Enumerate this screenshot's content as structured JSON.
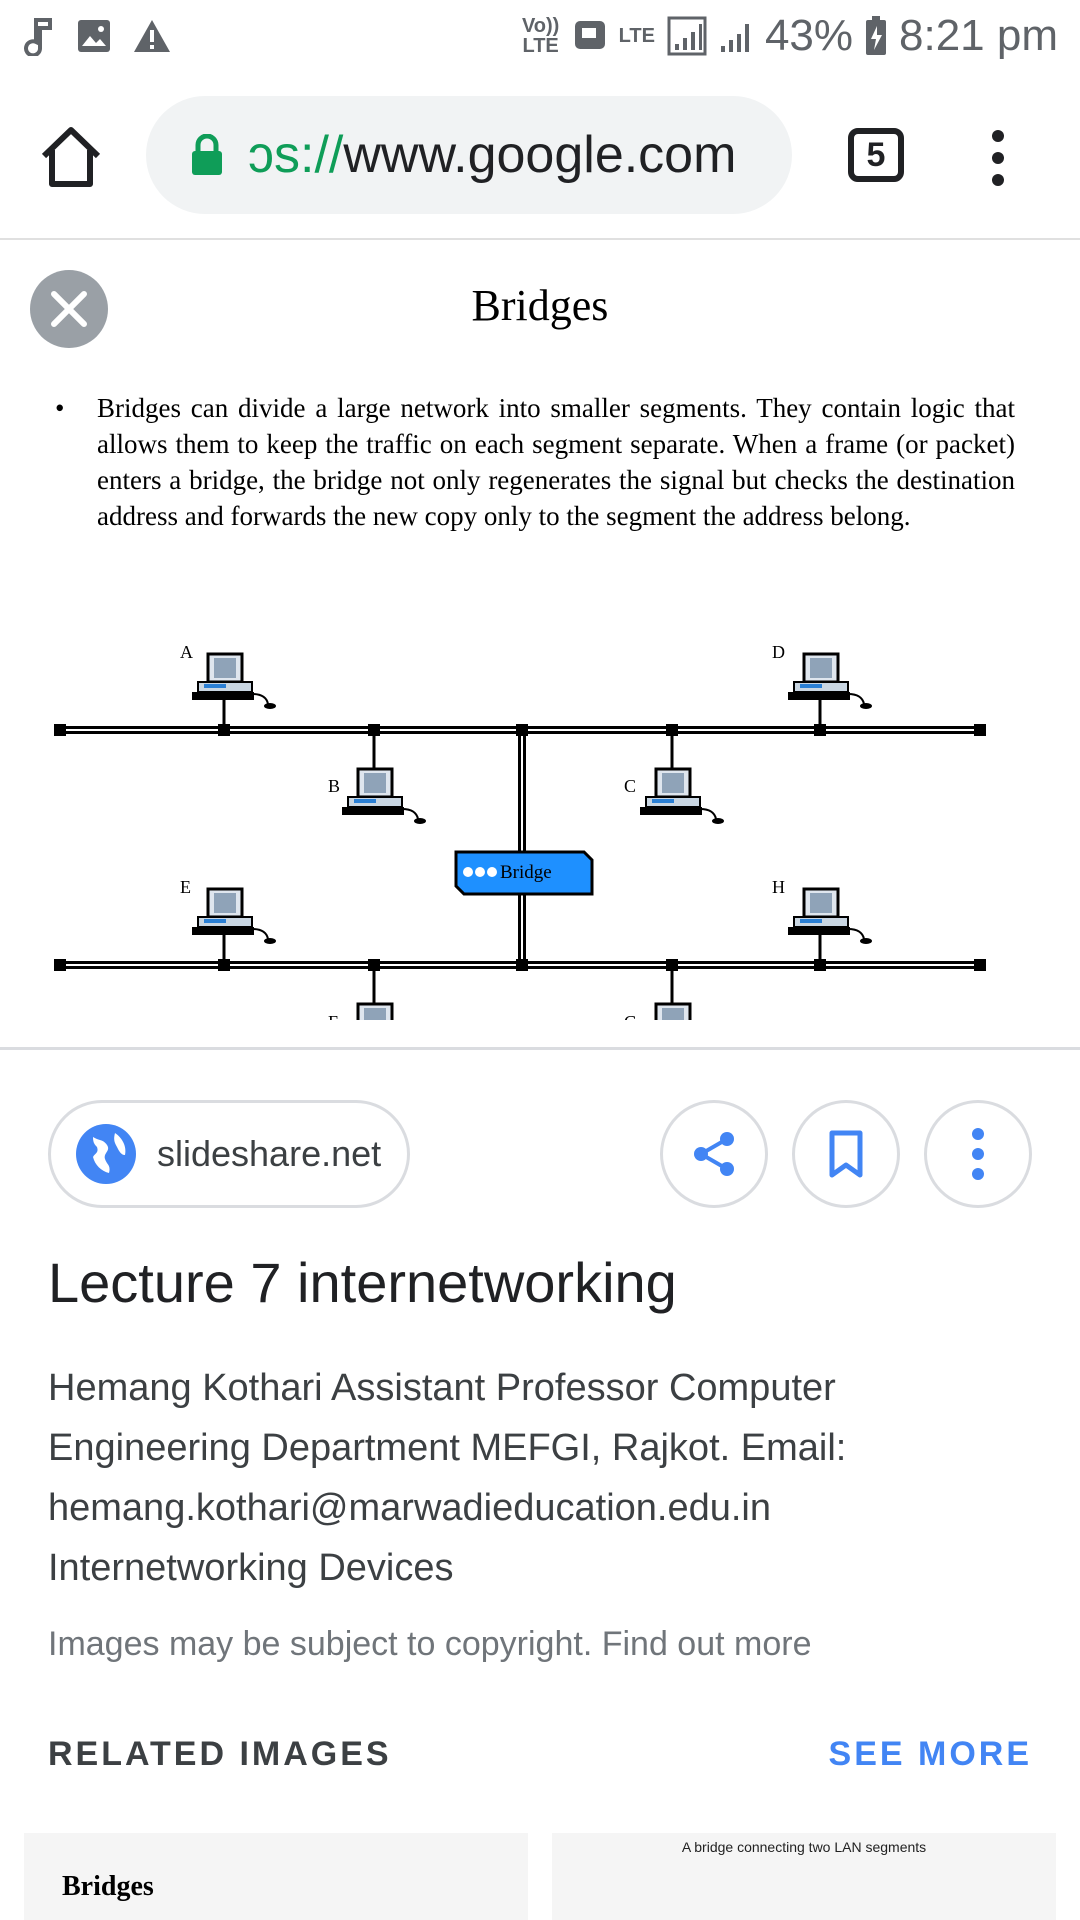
{
  "status_bar": {
    "volte": "Vo)) LTE",
    "lte": "LTE",
    "battery": "43%",
    "time": "8:21 pm"
  },
  "toolbar": {
    "url_scheme": "ɔs://",
    "url_host": "www.google.com",
    "tab_count": "5"
  },
  "viewer": {
    "slide_title": "Bridges",
    "slide_text": "Bridges can divide a large network into smaller segments. They contain logic that allows them to keep the traffic on each segment separate. When a frame (or packet) enters a bridge, the bridge not only regenerates the signal but checks the destination address and forwards the new copy only to the segment the address belong.",
    "bullet": "•",
    "bridge_label": "Bridge",
    "stations": [
      "A",
      "B",
      "C",
      "D",
      "E",
      "F",
      "G",
      "H"
    ]
  },
  "card": {
    "source": "slideshare.net",
    "title": "Lecture 7 internetworking",
    "description": "Hemang Kothari Assistant Professor Computer Engineering Department MEFGI, Rajkot. Email: hemang.kothari@marwadieducation.edu.in Internetworking Devices",
    "copyright": "Images may be subject to copyright. Find out more"
  },
  "related": {
    "heading": "RELATED IMAGES",
    "see_more": "SEE MORE",
    "thumb1_text": "Bridges",
    "thumb2_text": "A bridge connecting two LAN segments"
  }
}
